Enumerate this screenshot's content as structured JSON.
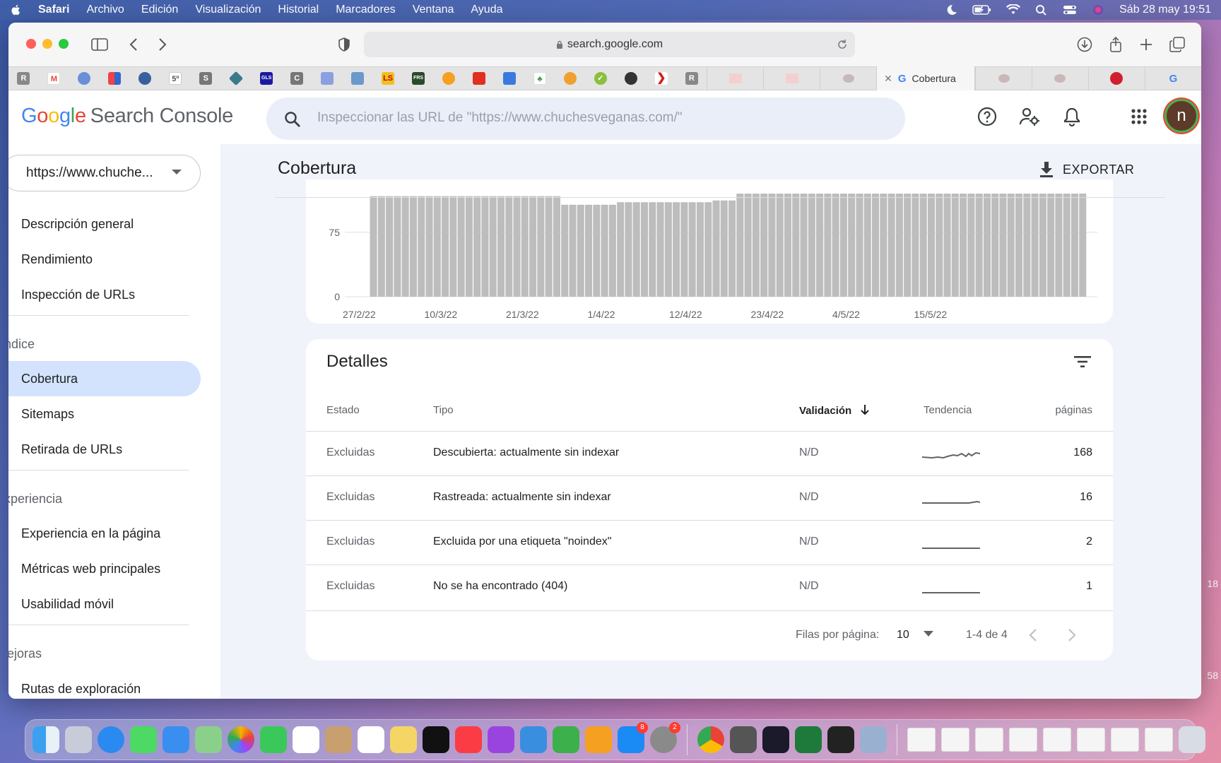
{
  "menubar": {
    "app_name": "Safari",
    "items": [
      "Archivo",
      "Edición",
      "Visualización",
      "Historial",
      "Marcadores",
      "Ventana",
      "Ayuda"
    ],
    "datetime": "Sáb 28 may  19:51"
  },
  "desktop": {
    "edge_num_1": "18",
    "edge_num_2": "58"
  },
  "browser": {
    "url": "search.google.com",
    "active_tab_title": "Cobertura"
  },
  "gsc": {
    "search_placeholder": "Inspeccionar las URL de \"https://www.chuchesveganas.com/\"",
    "avatar_letter": "n",
    "property": "https://www.chuche...",
    "nav": {
      "overview": "Descripción general",
      "performance": "Rendimiento",
      "url_inspection": "Inspección de URLs",
      "section_index": "ndice",
      "coverage": "Cobertura",
      "sitemaps": "Sitemaps",
      "removals": "Retirada de URLs",
      "section_experience": "xperiencia",
      "page_experience": "Experiencia en la página",
      "core_web_vitals": "Métricas web principales",
      "mobile_usability": "Usabilidad móvil",
      "section_enhancements": "lejoras",
      "breadcrumbs": "Rutas de exploración"
    },
    "page_title": "Cobertura",
    "export_label": "EXPORTAR"
  },
  "chart_data": {
    "type": "bar",
    "yticks": [
      "75",
      "0"
    ],
    "xticks": [
      "27/2/22",
      "10/3/22",
      "21/3/22",
      "1/4/22",
      "12/4/22",
      "23/4/22",
      "4/5/22",
      "15/5/22"
    ],
    "values": [
      117,
      117,
      117,
      117,
      117,
      117,
      117,
      117,
      117,
      117,
      117,
      117,
      117,
      117,
      117,
      117,
      117,
      117,
      117,
      117,
      117,
      117,
      117,
      117,
      107,
      107,
      107,
      107,
      107,
      107,
      107,
      110,
      110,
      110,
      110,
      110,
      110,
      110,
      110,
      110,
      110,
      110,
      110,
      112,
      112,
      112,
      120,
      120,
      120,
      120,
      120,
      120,
      120,
      120,
      120,
      120,
      120,
      120,
      120,
      120,
      120,
      120,
      120,
      120,
      120,
      120,
      120,
      120,
      120,
      120,
      120,
      120,
      120,
      120,
      120,
      120,
      120,
      120,
      120,
      120,
      120,
      120,
      120,
      120,
      120,
      120,
      120,
      120,
      120,
      120
    ],
    "ylim": [
      0,
      120
    ]
  },
  "details": {
    "title": "Detalles",
    "columns": {
      "estado": "Estado",
      "tipo": "Tipo",
      "validacion": "Validación",
      "tendencia": "Tendencia",
      "paginas": "páginas"
    },
    "rows": [
      {
        "estado": "Excluidas",
        "tipo": "Descubierta: actualmente sin indexar",
        "validacion": "N/D",
        "paginas": "168"
      },
      {
        "estado": "Excluidas",
        "tipo": "Rastreada: actualmente sin indexar",
        "validacion": "N/D",
        "paginas": "16"
      },
      {
        "estado": "Excluidas",
        "tipo": "Excluida por una etiqueta \"noindex\"",
        "validacion": "N/D",
        "paginas": "2"
      },
      {
        "estado": "Excluidas",
        "tipo": "No se ha encontrado (404)",
        "validacion": "N/D",
        "paginas": "1"
      }
    ],
    "pagination": {
      "rows_per_page_label": "Filas por página:",
      "rows_per_page": "10",
      "range": "1-4 de 4"
    }
  }
}
